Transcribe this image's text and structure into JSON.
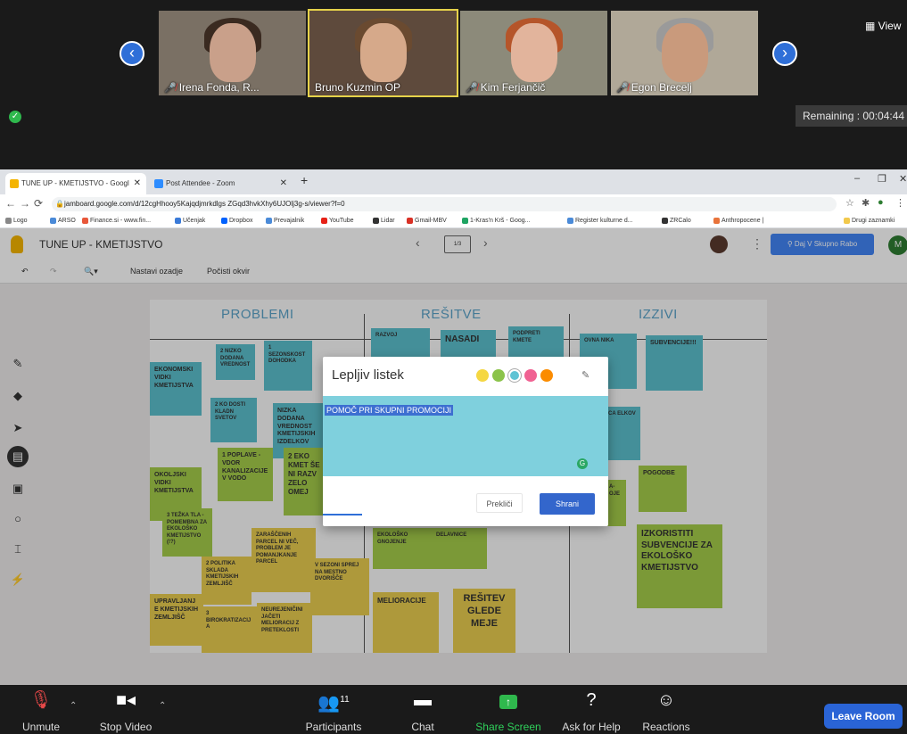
{
  "zoom": {
    "view_label": "View",
    "remaining": "Remaining : 00:04:44",
    "participants": [
      {
        "name": "Irena Fonda, R...",
        "muted": true
      },
      {
        "name": "Bruno Kuzmin OP",
        "muted": false
      },
      {
        "name": "Kim Ferjančič",
        "muted": true
      },
      {
        "name": "Egon Brecelj",
        "muted": true
      }
    ],
    "toolbar": {
      "unmute": "Unmute",
      "stop_video": "Stop Video",
      "participants": "Participants",
      "participants_count": "11",
      "chat": "Chat",
      "share_screen": "Share Screen",
      "ask_for_help": "Ask for Help",
      "reactions": "Reactions",
      "leave_room": "Leave Room"
    }
  },
  "browser": {
    "tabs": [
      {
        "label": "TUNE UP - KMETIJSTVO - Googl",
        "active": true
      },
      {
        "label": "Post Attendee - Zoom",
        "active": false
      }
    ],
    "url": "jamboard.google.com/d/12cgHhooy5Kajqdjmrkdlgs ZGqd3hvkXhy6UJOlj3g-s/viewer?f=0",
    "bookmarks": [
      "Logo",
      "ARSO",
      "Finance.si - www.fin...",
      "Učenjak",
      "Dropbox",
      "Prevajalnik",
      "YouTube",
      "Lidar",
      "Gmail-MBV",
      "1-Kras'n Krš - Goog...",
      "Register kulturne d...",
      "ZRCalo",
      "Anthropocene |",
      "Drugi zaznamki"
    ]
  },
  "jamboard": {
    "title": "TUNE UP - KMETIJSTVO",
    "frame_indicator": "1/3",
    "share_label": "Daj V Skupno Rabo",
    "avatar_letter": "M",
    "toolbar": {
      "set_background": "Nastavi ozadje",
      "clear_frame": "Počisti okvir"
    },
    "columns": [
      "PROBLEMI",
      "REŠITVE",
      "IZZIVI"
    ],
    "notes": [
      {
        "text": "EKONOMSKI VIDKI KMETIJSTVA",
        "color": "blue"
      },
      {
        "text": "2 NIZKO DODANA VREDNOST",
        "color": "blue"
      },
      {
        "text": "1 SEZONSKOST DOHODKA",
        "color": "blue"
      },
      {
        "text": "2 KO DOSTI KLADN SVETOV",
        "color": "blue"
      },
      {
        "text": "NIZKA DODANA VREDNOST KMETIJSKIH IZDELKOV",
        "color": "blue"
      },
      {
        "text": "RAZVOJ",
        "color": "blue"
      },
      {
        "text": "NASADI",
        "color": "blue"
      },
      {
        "text": "PODPRETI KMETE",
        "color": "blue"
      },
      {
        "text": "OVNA NIKA",
        "color": "blue"
      },
      {
        "text": "SUBVENCIJE!!!",
        "color": "blue"
      },
      {
        "text": "JICA ELKOV",
        "color": "blue"
      },
      {
        "text": "OKOLJSKI VIDKI KMETIJSTVA",
        "color": "green"
      },
      {
        "text": "1 POPLAVE - VDOR KANALIZACIJE V VODO",
        "color": "green"
      },
      {
        "text": "2 EKO KMET ŠE NI RAZV ZELO OMEJ",
        "color": "green"
      },
      {
        "text": "3 TEŽKA TLA - POMEMBNA ZA EKOLOŠKO KMETIJSTVO (!?)",
        "color": "green"
      },
      {
        "text": "EKOLOŠKO GNOJENJE",
        "color": "green"
      },
      {
        "text": "DELAVNICE",
        "color": "green"
      },
      {
        "text": "A- OJE",
        "color": "green"
      },
      {
        "text": "POGODBE",
        "color": "green"
      },
      {
        "text": "IZKORISTITI SUBVENCIJE ZA EKOLOŠKO KMETIJSTVO",
        "color": "green"
      },
      {
        "text": "ZARAŠČENIH PARCEL NI VEČ, PROBLEM JE POMANJKANJE PARCEL",
        "color": "yellow"
      },
      {
        "text": "2 POLITIKA SKLADA KMETIJSKIH ZEMLJIŠČ",
        "color": "yellow"
      },
      {
        "text": "V SEZONI SPREJ NA MESTNO DVORIŠČE",
        "color": "yellow"
      },
      {
        "text": "UPRAVLJANJE KMETIJSKIH ZEMLJIŠČ",
        "color": "yellow"
      },
      {
        "text": "3 BIROKRATIZACIJA",
        "color": "yellow"
      },
      {
        "text": "NEUREJENIČINI JAČETI MELIORACIJ Z PRETEKLOSTI",
        "color": "yellow"
      },
      {
        "text": "MELIORACIJE",
        "color": "yellow"
      },
      {
        "text": "REŠITEV GLEDE MEJE",
        "color": "yellow"
      }
    ],
    "dialog": {
      "title": "Lepljiv listek",
      "text": "POMOČ PRI SKUPNI PROMOCIJI",
      "cancel": "Prekliči",
      "save": "Shrani",
      "swatches": [
        "#f5d742",
        "#8bc34a",
        "#5ec3d4",
        "#f06292",
        "#fb8c00"
      ],
      "selected_swatch": 2
    }
  },
  "colors": {
    "blue": "#5bbfcc",
    "green": "#a4cc4a",
    "yellow": "#e9cd4f",
    "zoom_accent": "#2a64d6"
  }
}
